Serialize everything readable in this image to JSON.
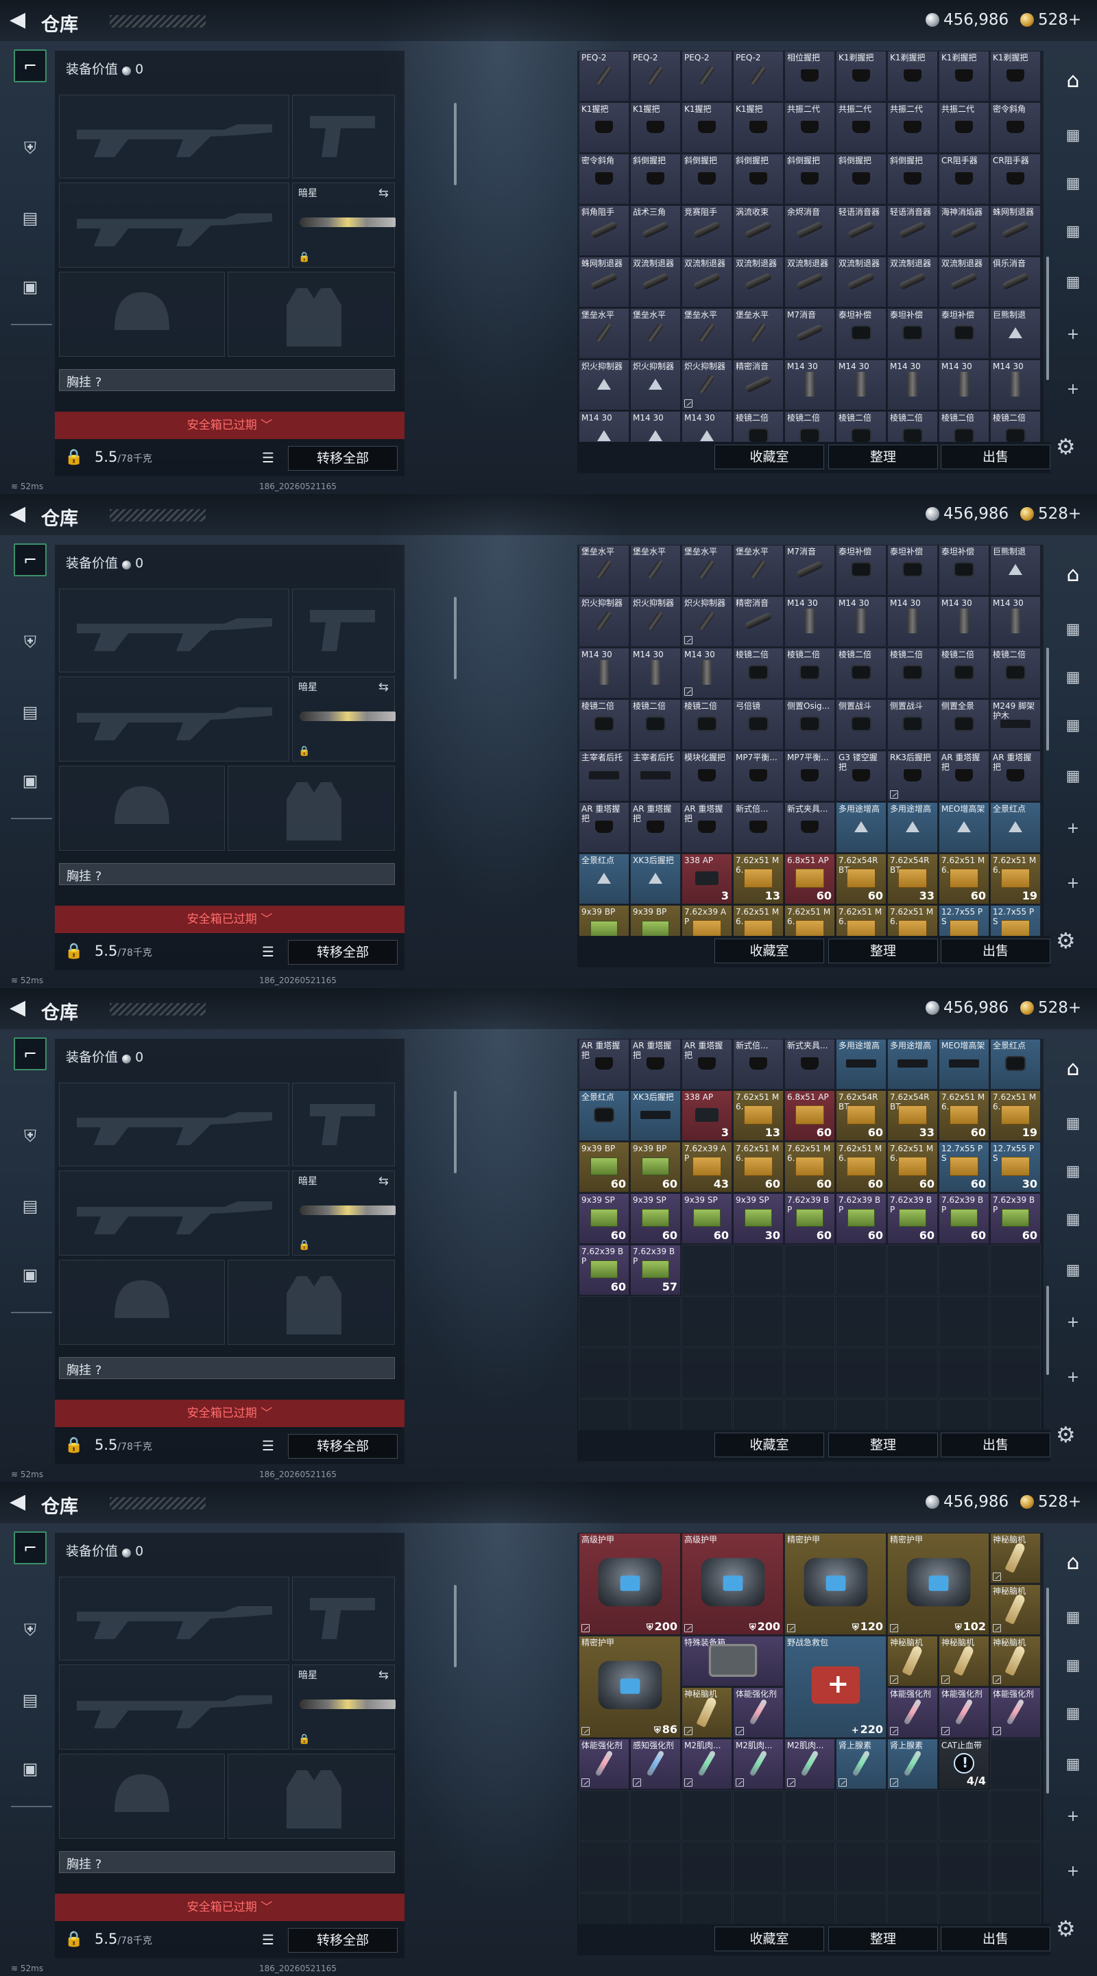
{
  "header": {
    "title": "仓库",
    "silver": "456,986",
    "gold": "528+"
  },
  "equipment": {
    "value_label": "装备价值",
    "value": "0",
    "melee_label": "暗星",
    "chest_label": "胸挂 ?",
    "expired_label": "安全箱已过期 ﹀",
    "weight": "5.5",
    "weight_cap": "/78千克",
    "transfer_label": "转移全部"
  },
  "stash_buttons": {
    "collection": "收藏室",
    "sort": "整理",
    "sell": "出售"
  },
  "status": {
    "ping": "52ms",
    "build": "186_20260521165"
  },
  "colors": {
    "accent_green": "#3c8f6a",
    "expired_red": "#7a1f23",
    "expired_text": "#ff6d6d"
  },
  "icons": {
    "back": "back-arrow-icon",
    "settings": "gear-icon",
    "lock": "lock-icon",
    "list": "list-icon",
    "swap": "swap-icon"
  },
  "frames": [
    {
      "cells": [
        {
          "n": "PEQ-2",
          "i": "stick"
        },
        {
          "n": "PEQ-2",
          "i": "stick"
        },
        {
          "n": "PEQ-2",
          "i": "stick"
        },
        {
          "n": "PEQ-2",
          "i": "stick"
        },
        {
          "n": "相位握把",
          "i": "grip"
        },
        {
          "n": "K1剃握把",
          "i": "grip"
        },
        {
          "n": "K1剃握把",
          "i": "grip"
        },
        {
          "n": "K1剃握把",
          "i": "grip"
        },
        {
          "n": "K1剃握把",
          "i": "grip"
        },
        {
          "n": "K1握把",
          "i": "grip"
        },
        {
          "n": "K1握把",
          "i": "grip"
        },
        {
          "n": "K1握把",
          "i": "grip"
        },
        {
          "n": "K1握把",
          "i": "grip"
        },
        {
          "n": "共振二代",
          "i": "grip"
        },
        {
          "n": "共振二代",
          "i": "grip"
        },
        {
          "n": "共振二代",
          "i": "grip"
        },
        {
          "n": "共振二代",
          "i": "grip"
        },
        {
          "n": "密令斜角",
          "i": "grip"
        },
        {
          "n": "密令斜角",
          "i": "grip"
        },
        {
          "n": "斜倒握把",
          "i": "grip"
        },
        {
          "n": "斜倒握把",
          "i": "grip"
        },
        {
          "n": "斜倒握把",
          "i": "grip"
        },
        {
          "n": "斜倒握把",
          "i": "grip"
        },
        {
          "n": "斜倒握把",
          "i": "grip"
        },
        {
          "n": "斜倒握把",
          "i": "grip"
        },
        {
          "n": "CR阻手器",
          "i": "grip"
        },
        {
          "n": "CR阻手器",
          "i": "grip"
        },
        {
          "n": "斜角阻手",
          "i": "tube"
        },
        {
          "n": "战术三角",
          "i": "tube"
        },
        {
          "n": "竞赛阻手",
          "i": "tube"
        },
        {
          "n": "涡流收束",
          "i": "tube"
        },
        {
          "n": "余烬消音",
          "i": "tube"
        },
        {
          "n": "轻语消音器",
          "i": "tube"
        },
        {
          "n": "轻语消音器",
          "i": "tube"
        },
        {
          "n": "海神消焰器",
          "i": "tube"
        },
        {
          "n": "蛛网制退器",
          "i": "tube"
        },
        {
          "n": "蛛网制退器",
          "i": "tube"
        },
        {
          "n": "双流制退器",
          "i": "tube"
        },
        {
          "n": "双流制退器",
          "i": "tube"
        },
        {
          "n": "双流制退器",
          "i": "tube"
        },
        {
          "n": "双流制退器",
          "i": "tube"
        },
        {
          "n": "双流制退器",
          "i": "tube"
        },
        {
          "n": "双流制退器",
          "i": "tube"
        },
        {
          "n": "双流制退器",
          "i": "tube"
        },
        {
          "n": "俱乐消音",
          "i": "tube"
        },
        {
          "n": "堡垒水平",
          "i": "stick"
        },
        {
          "n": "堡垒水平",
          "i": "stick"
        },
        {
          "n": "堡垒水平",
          "i": "stick"
        },
        {
          "n": "堡垒水平",
          "i": "stick"
        },
        {
          "n": "M7消音",
          "i": "tube"
        },
        {
          "n": "泰坦补偿",
          "i": "scope"
        },
        {
          "n": "泰坦补偿",
          "i": "scope"
        },
        {
          "n": "泰坦补偿",
          "i": "scope"
        },
        {
          "n": "巨熊制退",
          "i": "tri"
        },
        {
          "n": "炽火抑制器",
          "i": "tri"
        },
        {
          "n": "炽火抑制器",
          "i": "tri"
        },
        {
          "n": "炽火抑制器",
          "i": "stick",
          "b": true
        },
        {
          "n": "精密消音",
          "i": "tube"
        },
        {
          "n": "M14 30",
          "i": "mag"
        },
        {
          "n": "M14 30",
          "i": "mag"
        },
        {
          "n": "M14 30",
          "i": "mag"
        },
        {
          "n": "M14 30",
          "i": "mag"
        },
        {
          "n": "M14 30",
          "i": "mag"
        },
        {
          "n": "M14 30",
          "i": "tri"
        },
        {
          "n": "M14 30",
          "i": "tri"
        },
        {
          "n": "M14 30",
          "i": "tri"
        },
        {
          "n": "棱镜二倍",
          "i": "scope"
        },
        {
          "n": "棱镜二倍",
          "i": "scope"
        },
        {
          "n": "棱镜二倍",
          "i": "scope"
        },
        {
          "n": "棱镜二倍",
          "i": "scope"
        },
        {
          "n": "棱镜二倍",
          "i": "scope"
        },
        {
          "n": "棱镜二倍",
          "i": "scope"
        }
      ]
    },
    {
      "cells": [
        {
          "n": "堡垒水平",
          "i": "stick"
        },
        {
          "n": "堡垒水平",
          "i": "stick"
        },
        {
          "n": "堡垒水平",
          "i": "stick"
        },
        {
          "n": "堡垒水平",
          "i": "stick"
        },
        {
          "n": "M7消音",
          "i": "tube"
        },
        {
          "n": "泰坦补偿",
          "i": "scope"
        },
        {
          "n": "泰坦补偿",
          "i": "scope"
        },
        {
          "n": "泰坦补偿",
          "i": "scope"
        },
        {
          "n": "巨熊制退",
          "i": "tri"
        },
        {
          "n": "炽火抑制器",
          "i": "stick"
        },
        {
          "n": "炽火抑制器",
          "i": "stick"
        },
        {
          "n": "炽火抑制器",
          "i": "stick",
          "b": true
        },
        {
          "n": "精密消音",
          "i": "tube"
        },
        {
          "n": "M14 30",
          "i": "mag"
        },
        {
          "n": "M14 30",
          "i": "mag"
        },
        {
          "n": "M14 30",
          "i": "mag"
        },
        {
          "n": "M14 30",
          "i": "mag"
        },
        {
          "n": "M14 30",
          "i": "mag"
        },
        {
          "n": "M14 30",
          "i": "mag"
        },
        {
          "n": "M14 30",
          "i": "mag"
        },
        {
          "n": "M14 30",
          "i": "mag",
          "b": true
        },
        {
          "n": "棱镜二倍",
          "i": "scope"
        },
        {
          "n": "棱镜二倍",
          "i": "scope"
        },
        {
          "n": "棱镜二倍",
          "i": "scope"
        },
        {
          "n": "棱镜二倍",
          "i": "scope"
        },
        {
          "n": "棱镜二倍",
          "i": "scope"
        },
        {
          "n": "棱镜二倍",
          "i": "scope"
        },
        {
          "n": "棱镜二倍",
          "i": "scope"
        },
        {
          "n": "棱镜二倍",
          "i": "scope"
        },
        {
          "n": "棱镜二倍",
          "i": "scope"
        },
        {
          "n": "弓倍镜",
          "i": "scope"
        },
        {
          "n": "侧置Osig...",
          "i": "scope"
        },
        {
          "n": "侧置战斗",
          "i": "scope"
        },
        {
          "n": "侧置战斗",
          "i": "scope"
        },
        {
          "n": "侧置全景",
          "i": "scope"
        },
        {
          "n": "M249 脚架护木",
          "i": "gun"
        },
        {
          "n": "主宰者后托",
          "i": "gun"
        },
        {
          "n": "主宰者后托",
          "i": "gun"
        },
        {
          "n": "模块化握把",
          "i": "grip"
        },
        {
          "n": "MP7平衡...",
          "i": "grip"
        },
        {
          "n": "MP7平衡...",
          "i": "grip"
        },
        {
          "n": "G3 镂空握把",
          "i": "grip"
        },
        {
          "n": "RK3后握把",
          "i": "grip",
          "b": true
        },
        {
          "n": "AR 重塔握把",
          "i": "grip"
        },
        {
          "n": "AR 重塔握把",
          "i": "grip"
        },
        {
          "n": "AR 重塔握把",
          "i": "grip"
        },
        {
          "n": "AR 重塔握把",
          "i": "grip"
        },
        {
          "n": "AR 重塔握把",
          "i": "grip"
        },
        {
          "n": "新式倍...",
          "i": "grip"
        },
        {
          "n": "新式夹具...",
          "i": "grip"
        },
        {
          "n": "多用途增高",
          "i": "tri",
          "c": "c-blue"
        },
        {
          "n": "多用途增高",
          "i": "tri",
          "c": "c-blue"
        },
        {
          "n": "MEO增高架",
          "i": "tri",
          "c": "c-blue"
        },
        {
          "n": "全景红点",
          "i": "tri",
          "c": "c-blue"
        },
        {
          "n": "全景红点",
          "i": "tri",
          "c": "c-blue"
        },
        {
          "n": "XK3后握把",
          "i": "tri",
          "c": "c-blue"
        },
        {
          "n": "338 AP",
          "i": "wip",
          "q": "3",
          "c": "c-red"
        },
        {
          "n": "7.62x51 M6...",
          "i": "box",
          "q": "13",
          "c": "c-gold"
        },
        {
          "n": "6.8x51 AP",
          "i": "box",
          "q": "60",
          "c": "c-red"
        },
        {
          "n": "7.62x54R BT",
          "i": "box",
          "q": "60",
          "c": "c-gold"
        },
        {
          "n": "7.62x54R BT",
          "i": "box",
          "q": "33",
          "c": "c-gold"
        },
        {
          "n": "7.62x51 M6...",
          "i": "box",
          "q": "60",
          "c": "c-gold"
        },
        {
          "n": "7.62x51 M6...",
          "i": "box",
          "q": "19",
          "c": "c-gold"
        },
        {
          "n": "9x39 BP",
          "i": "greenbox",
          "c": "c-gold"
        },
        {
          "n": "9x39 BP",
          "i": "greenbox",
          "c": "c-gold"
        },
        {
          "n": "7.62x39 AP",
          "i": "box",
          "c": "c-gold"
        },
        {
          "n": "7.62x51 M6...",
          "i": "box",
          "c": "c-gold"
        },
        {
          "n": "7.62x51 M6...",
          "i": "box",
          "c": "c-gold"
        },
        {
          "n": "7.62x51 M6...",
          "i": "box",
          "c": "c-gold"
        },
        {
          "n": "7.62x51 M6...",
          "i": "box",
          "c": "c-gold"
        },
        {
          "n": "12.7x55 PS",
          "i": "box",
          "c": "c-blue"
        },
        {
          "n": "12.7x55 PS",
          "i": "box",
          "c": "c-blue"
        }
      ]
    },
    {
      "cells": [
        {
          "n": "AR 重塔握把",
          "i": "grip"
        },
        {
          "n": "AR 重塔握把",
          "i": "grip"
        },
        {
          "n": "AR 重塔握把",
          "i": "grip"
        },
        {
          "n": "新式倍...",
          "i": "grip"
        },
        {
          "n": "新式夹具...",
          "i": "grip"
        },
        {
          "n": "多用途增高",
          "i": "gun",
          "c": "c-blue"
        },
        {
          "n": "多用途增高",
          "i": "gun",
          "c": "c-blue"
        },
        {
          "n": "MEO增高架",
          "i": "gun",
          "c": "c-blue"
        },
        {
          "n": "全景红点",
          "i": "scope",
          "c": "c-blue"
        },
        {
          "n": "全景红点",
          "i": "scope",
          "c": "c-blue"
        },
        {
          "n": "XK3后握把",
          "i": "gun",
          "c": "c-blue"
        },
        {
          "n": "338 AP",
          "i": "wip",
          "q": "3",
          "c": "c-red"
        },
        {
          "n": "7.62x51 M6...",
          "i": "box",
          "q": "13",
          "c": "c-gold"
        },
        {
          "n": "6.8x51 AP",
          "i": "box",
          "q": "60",
          "c": "c-red"
        },
        {
          "n": "7.62x54R BT",
          "i": "box",
          "q": "60",
          "c": "c-gold"
        },
        {
          "n": "7.62x54R BT",
          "i": "box",
          "q": "33",
          "c": "c-gold"
        },
        {
          "n": "7.62x51 M6...",
          "i": "box",
          "q": "60",
          "c": "c-gold"
        },
        {
          "n": "7.62x51 M6...",
          "i": "box",
          "q": "19",
          "c": "c-gold"
        },
        {
          "n": "9x39 BP",
          "i": "greenbox",
          "q": "60",
          "c": "c-gold"
        },
        {
          "n": "9x39 BP",
          "i": "greenbox",
          "q": "60",
          "c": "c-gold"
        },
        {
          "n": "7.62x39 AP",
          "i": "box",
          "q": "43",
          "c": "c-gold"
        },
        {
          "n": "7.62x51 M6...",
          "i": "box",
          "q": "60",
          "c": "c-gold"
        },
        {
          "n": "7.62x51 M6...",
          "i": "box",
          "q": "60",
          "c": "c-gold"
        },
        {
          "n": "7.62x51 M6...",
          "i": "box",
          "q": "60",
          "c": "c-gold"
        },
        {
          "n": "7.62x51 M6...",
          "i": "box",
          "q": "60",
          "c": "c-gold"
        },
        {
          "n": "12.7x55 PS",
          "i": "box",
          "q": "60",
          "c": "c-blue"
        },
        {
          "n": "12.7x55 PS",
          "i": "box",
          "q": "30",
          "c": "c-blue"
        },
        {
          "n": "9x39 SP",
          "i": "greenbox",
          "q": "60",
          "c": "c-purple"
        },
        {
          "n": "9x39 SP",
          "i": "greenbox",
          "q": "60",
          "c": "c-purple"
        },
        {
          "n": "9x39 SP",
          "i": "greenbox",
          "q": "60",
          "c": "c-purple"
        },
        {
          "n": "9x39 SP",
          "i": "greenbox",
          "q": "30",
          "c": "c-purple"
        },
        {
          "n": "7.62x39 BP",
          "i": "greenbox",
          "q": "60",
          "c": "c-purple"
        },
        {
          "n": "7.62x39 BP",
          "i": "greenbox",
          "q": "60",
          "c": "c-purple"
        },
        {
          "n": "7.62x39 BP",
          "i": "greenbox",
          "q": "60",
          "c": "c-purple"
        },
        {
          "n": "7.62x39 BP",
          "i": "greenbox",
          "q": "60",
          "c": "c-purple"
        },
        {
          "n": "7.62x39 BP",
          "i": "greenbox",
          "q": "60",
          "c": "c-purple"
        },
        {
          "n": "7.62x39 BP",
          "i": "greenbox",
          "q": "60",
          "c": "c-purple"
        },
        {
          "n": "7.62x39 BP",
          "i": "greenbox",
          "q": "57",
          "c": "c-purple"
        }
      ]
    },
    {
      "cells": [
        {
          "n": "高级护甲",
          "i": "bag",
          "q": "200",
          "s": true,
          "b": true,
          "c": "c-red",
          "w": 2,
          "h": 2
        },
        {
          "n": "高级护甲",
          "i": "bag",
          "q": "200",
          "s": true,
          "b": true,
          "c": "c-red",
          "w": 2,
          "h": 2
        },
        {
          "n": "精密护甲",
          "i": "bag",
          "q": "120",
          "s": true,
          "b": true,
          "c": "c-gold",
          "w": 2,
          "h": 2
        },
        {
          "n": "精密护甲",
          "i": "bag",
          "q": "102",
          "s": true,
          "b": true,
          "c": "c-gold",
          "w": 2,
          "h": 2
        },
        {
          "n": "神秘脑机",
          "i": "horn",
          "b": true,
          "c": "c-gold"
        },
        {
          "n": "神秘脑机",
          "i": "horn",
          "b": true,
          "c": "c-gold"
        },
        {
          "n": "精密护甲",
          "i": "bag",
          "q": "86",
          "s": true,
          "b": true,
          "c": "c-gold",
          "w": 2,
          "h": 2
        },
        {
          "n": "特殊装备箱",
          "i": "case",
          "c": "c-purple",
          "w": 2
        },
        {
          "n": "野战急救包",
          "i": "medkit",
          "q": "220",
          "p": true,
          "c": "c-blue",
          "w": 2,
          "h": 2
        },
        {
          "n": "神秘脑机",
          "i": "horn",
          "b": true,
          "c": "c-gold"
        },
        {
          "n": "神秘脑机",
          "i": "horn",
          "b": true,
          "c": "c-gold"
        },
        {
          "n": "神秘脑机",
          "i": "horn",
          "b": true,
          "c": "c-gold"
        },
        {
          "n": "神秘脑机",
          "i": "horn",
          "b": true,
          "c": "c-gold"
        },
        {
          "n": "体能强化剂",
          "i": "syr",
          "b": true,
          "c": "c-purple"
        },
        {
          "n": "体能强化剂",
          "i": "syr",
          "b": true,
          "c": "c-purple"
        },
        {
          "n": "体能强化剂",
          "i": "syr",
          "b": true,
          "c": "c-purple"
        },
        {
          "n": "体能强化剂",
          "i": "syr",
          "b": true,
          "c": "c-purple"
        },
        {
          "n": "体能强化剂",
          "i": "syr",
          "b": true,
          "c": "c-purple"
        },
        {
          "n": "感知强化剂",
          "i": "syrb",
          "b": true,
          "c": "c-purple"
        },
        {
          "n": "M2肌肉...",
          "i": "syrg",
          "b": true,
          "c": "c-purple"
        },
        {
          "n": "M2肌肉...",
          "i": "syrg",
          "b": true,
          "c": "c-purple"
        },
        {
          "n": "M2肌肉...",
          "i": "syrg",
          "b": true,
          "c": "c-purple"
        },
        {
          "n": "肾上腺素",
          "i": "syrg",
          "b": true,
          "c": "c-blue"
        },
        {
          "n": "肾上腺素",
          "i": "syrg",
          "b": true,
          "c": "c-blue"
        },
        {
          "n": "CAT止血带",
          "i": "alert",
          "q": "4/4",
          "c": "c-dark"
        }
      ]
    }
  ]
}
